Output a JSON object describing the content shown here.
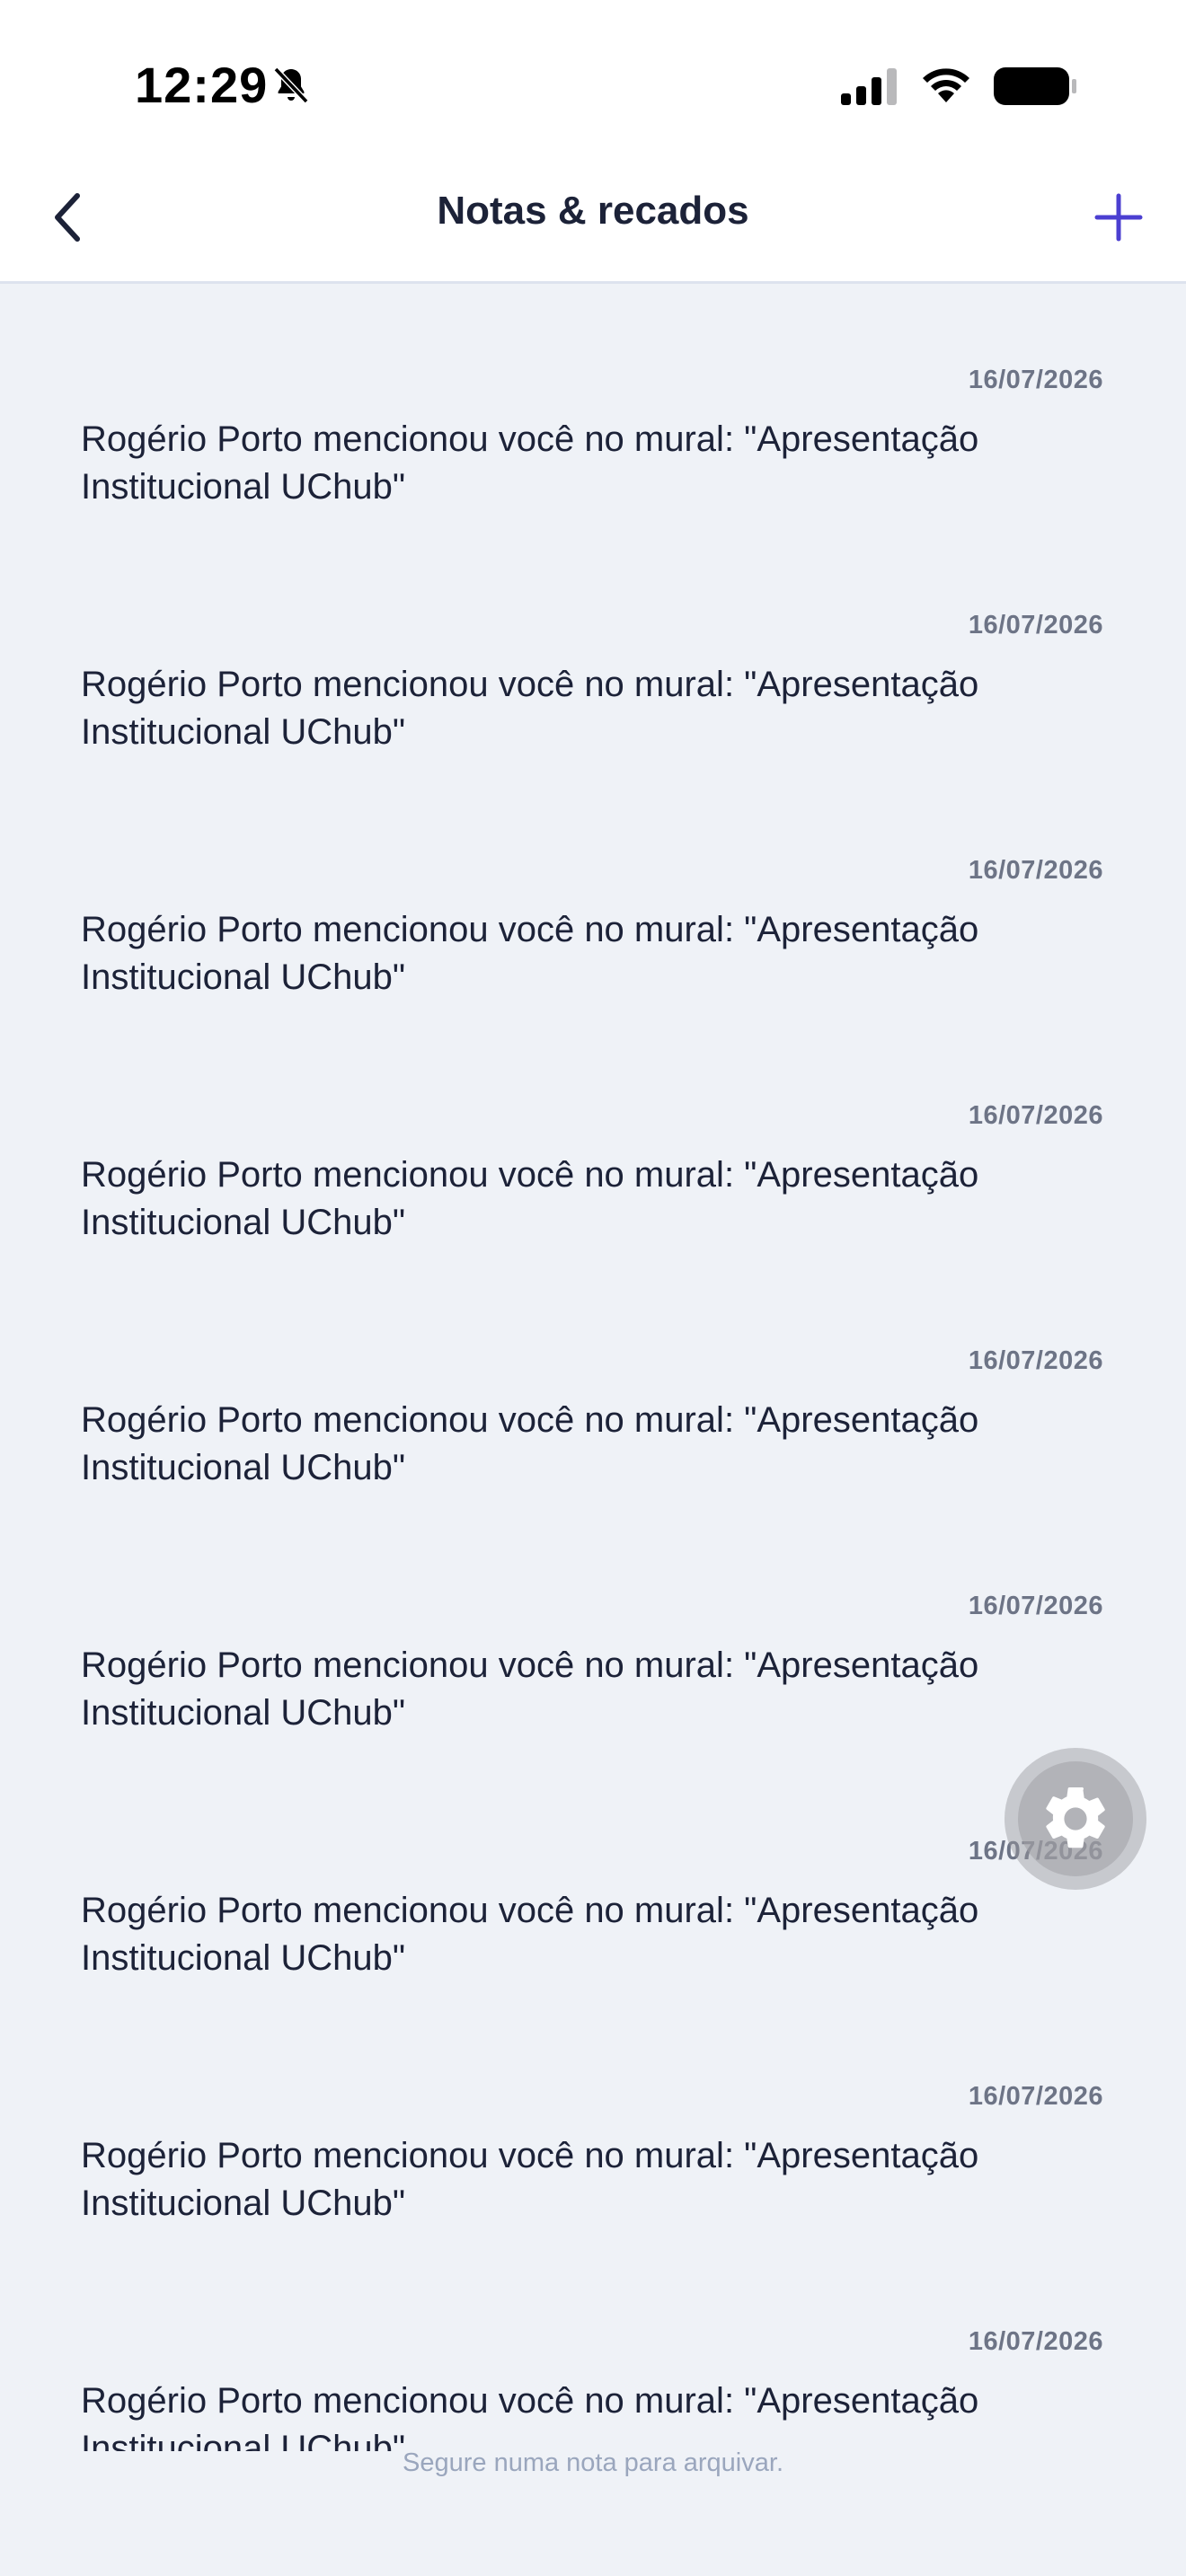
{
  "status_bar": {
    "time": "12:29"
  },
  "nav": {
    "title": "Notas & recados"
  },
  "notes": [
    {
      "date": "16/07/2026",
      "text": "Rogério Porto mencionou você no mural: \"Apresentação Institucional UChub\""
    },
    {
      "date": "16/07/2026",
      "text": "Rogério Porto mencionou você no mural: \"Apresentação Institucional UChub\""
    },
    {
      "date": "16/07/2026",
      "text": "Rogério Porto mencionou você no mural: \"Apresentação Institucional UChub\""
    },
    {
      "date": "16/07/2026",
      "text": "Rogério Porto mencionou você no mural: \"Apresentação Institucional UChub\""
    },
    {
      "date": "16/07/2026",
      "text": "Rogério Porto mencionou você no mural: \"Apresentação Institucional UChub\""
    },
    {
      "date": "16/07/2026",
      "text": "Rogério Porto mencionou você no mural: \"Apresentação Institucional UChub\""
    },
    {
      "date": "16/07/2026",
      "text": "Rogério Porto mencionou você no mural: \"Apresentação Institucional UChub\""
    },
    {
      "date": "16/07/2026",
      "text": "Rogério Porto mencionou você no mural: \"Apresentação Institucional UChub\""
    },
    {
      "date": "16/07/2026",
      "text": "Rogério Porto mencionou você no mural: \"Apresentação Institucional UChub\""
    }
  ],
  "hint": "Segure numa nota para arquivar.",
  "icons": {
    "back": "chevron-left-icon",
    "add": "plus-icon",
    "settings": "gear-icon",
    "bell": "bell-off-icon"
  },
  "colors": {
    "accent": "#4b3fd1",
    "background": "#eff2f7"
  }
}
